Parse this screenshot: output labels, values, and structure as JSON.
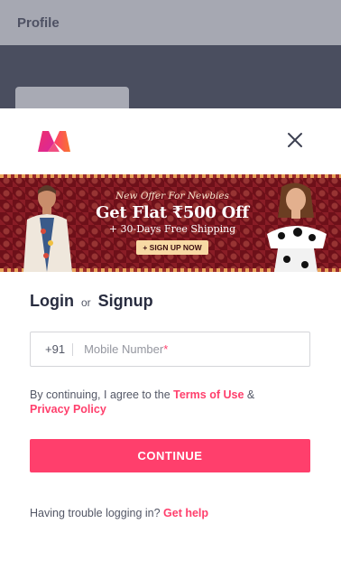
{
  "background": {
    "title": "Profile"
  },
  "logo": {
    "icon": "myntra-logo-icon"
  },
  "close": {
    "icon": "close-icon"
  },
  "banner": {
    "line1": "New Offer For Newbies",
    "line2": "Get Flat ₹500 Off",
    "line3": "+ 30-Days Free Shipping",
    "cta": "+ SIGN UP NOW"
  },
  "heading": {
    "login": "Login",
    "or": "or",
    "signup": "Signup"
  },
  "phone": {
    "code": "+91",
    "placeholder": "Mobile Number",
    "required_mark": "*"
  },
  "terms": {
    "prefix": "By continuing, I agree to the ",
    "terms_link": "Terms of Use",
    "middle": " &",
    "privacy_link": "Privacy Policy"
  },
  "continue_label": "CONTINUE",
  "help": {
    "text": "Having trouble logging in? ",
    "link": "Get help"
  },
  "colors": {
    "accent": "#ff3f6c",
    "text": "#282c3f",
    "muted": "#535766"
  }
}
